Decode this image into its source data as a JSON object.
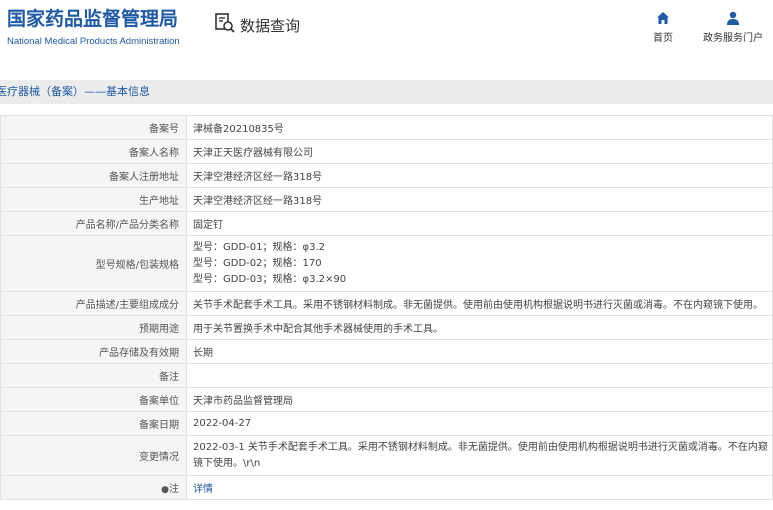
{
  "header": {
    "logo_cn": "国家药品监督管理局",
    "logo_en": "National Medical Products Administration",
    "query_label": "数据查询",
    "nav_home": "首页",
    "nav_portal": "政务服务门户"
  },
  "breadcrumb": "医疗器械（备案）——基本信息",
  "record": {
    "filing_no_label": "备案号",
    "filing_no": "津械备20210835号",
    "filer_name_label": "备案人名称",
    "filer_name": "天津正天医疗器械有限公司",
    "filer_address_label": "备案人注册地址",
    "filer_address": "天津空港经济区经一路318号",
    "production_address_label": "生产地址",
    "production_address": "天津空港经济区经一路318号",
    "product_name_label": "产品名称/产品分类名称",
    "product_name": "固定钉",
    "models_label": "型号规格/包装规格",
    "models": [
      "型号：GDD-01；规格：φ3.2",
      "型号：GDD-02；规格：170",
      "型号：GDD-03；规格：φ3.2×90"
    ],
    "description_label": "产品描述/主要组成成分",
    "description": "关节手术配套手术工具。采用不锈钢材料制成。非无菌提供。使用前由使用机构根据说明书进行灭菌或消毒。不在内窥镜下使用。",
    "intended_use_label": "预期用途",
    "intended_use": "用于关节置换手术中配合其他手术器械使用的手术工具。",
    "storage_label": "产品存储及有效期",
    "storage": "长期",
    "remark_label": "备注",
    "remark": "",
    "filing_unit_label": "备案单位",
    "filing_unit": "天津市药品监督管理局",
    "filing_date_label": "备案日期",
    "filing_date": "2022-04-27",
    "change_label": "变更情况",
    "change": "2022-03-1 关节手术配套手术工具。采用不锈钢材料制成。非无菌提供。使用前由使用机构根据说明书进行灭菌或消毒。不在内窥镜下使用。\\r\\n",
    "note_label": "注",
    "note_link": "详情"
  }
}
